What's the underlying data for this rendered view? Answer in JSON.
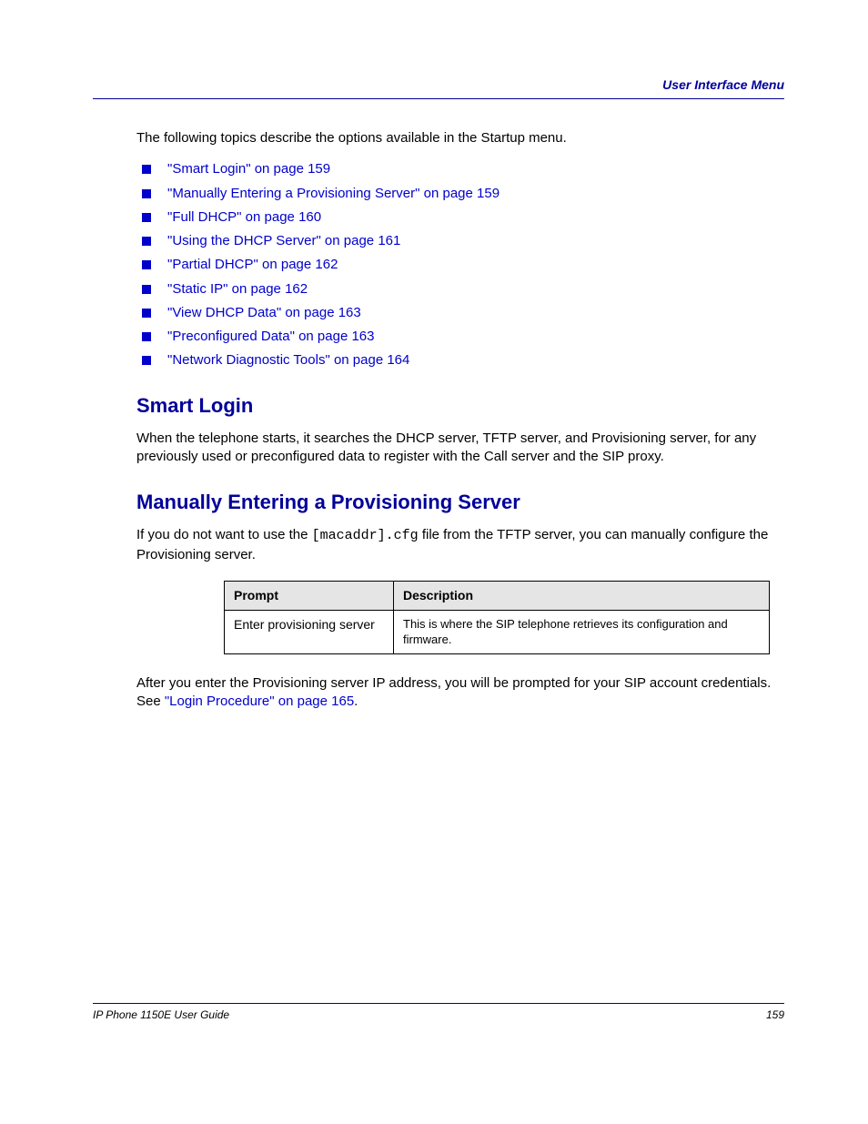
{
  "header": {
    "title": "User Interface Menu"
  },
  "footer": {
    "left": "IP Phone 1150E User Guide",
    "right": "159"
  },
  "intro": "The following topics describe the options available in the Startup menu.",
  "bullets": [
    {
      "label": "\"Smart Login\"",
      "page": "159"
    },
    {
      "label": "\"Manually Entering a Provisioning Server\"",
      "page": "159"
    },
    {
      "label": "\"Full DHCP\"",
      "page": "160"
    },
    {
      "label": "\"Using the DHCP Server\"",
      "page": "161"
    },
    {
      "label": "\"Partial DHCP\"",
      "page": "162"
    },
    {
      "label": "\"Static IP\"",
      "page": "162"
    },
    {
      "label": "\"View DHCP Data\"",
      "page": "163"
    },
    {
      "label": "\"Preconfigured Data\"",
      "page": "163"
    },
    {
      "label": "\"Network Diagnostic Tools\"",
      "page": "164"
    }
  ],
  "section1": {
    "heading": "Smart Login",
    "para": "When the telephone starts, it searches the DHCP server, TFTP server, and Provisioning server, for any previously used or preconfigured data to register with the Call server and the SIP proxy."
  },
  "section2": {
    "heading": "Manually Entering a Provisioning Server",
    "para_before": "If you do not want to use the ",
    "para_code": "[macaddr].cfg",
    "para_after": " file from the TFTP server, you can manually configure the Provisioning server.",
    "table": {
      "col1_header": "Prompt",
      "col2_header": "Description",
      "row1_col1": "Enter provisioning server",
      "row1_col2": "This is where the SIP telephone retrieves its configuration and firmware."
    },
    "post_table": "After you enter the Provisioning server IP address, you will be prompted for your SIP account credentials. See ",
    "post_table_link": "\"Login Procedure\" on page 165",
    "post_table_period": "."
  }
}
